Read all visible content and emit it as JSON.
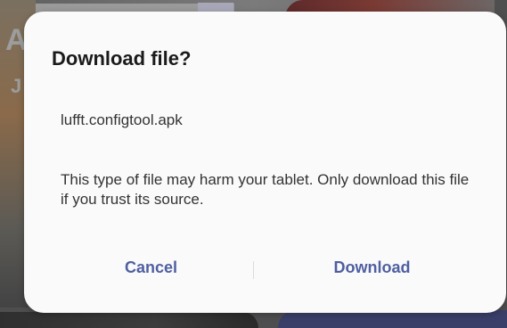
{
  "dialog": {
    "title": "Download file?",
    "file_name": "lufft.configtool.apk",
    "warning": "This type of file may harm your tablet. Only download this file if you trust its source.",
    "cancel_label": "Cancel",
    "download_label": "Download"
  },
  "background": {
    "letter_a": "A",
    "letter_j": "J"
  },
  "colors": {
    "accent": "#4f5fa0",
    "dialog_bg": "#fafafa",
    "scrim": "#6f6f6f"
  }
}
